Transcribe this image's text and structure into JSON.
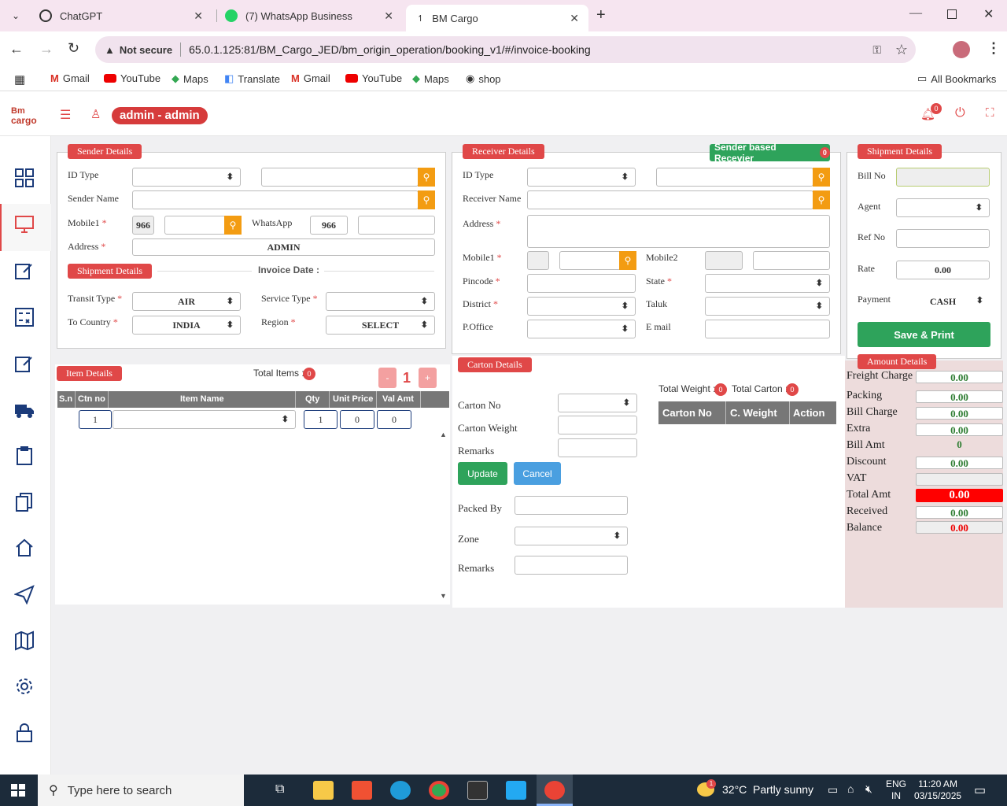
{
  "browser": {
    "tabs": [
      {
        "title": "ChatGPT"
      },
      {
        "title": "(7) WhatsApp Business"
      },
      {
        "title": "BM Cargo"
      }
    ],
    "security": "Not secure",
    "url": "65.0.1.125:81/BM_Cargo_JED/bm_origin_operation/booking_v1/#/invoice-booking",
    "bookmarks": [
      "Gmail",
      "YouTube",
      "Maps",
      "Translate",
      "Gmail",
      "YouTube",
      "Maps",
      "shop"
    ],
    "all_bookmarks": "All Bookmarks"
  },
  "app": {
    "logo_top": "Bm",
    "logo_bottom": "cargo",
    "user": "admin - admin",
    "notif_count": "0"
  },
  "sender": {
    "title": "Sender Details",
    "id_type": "ID Type",
    "sender_name": "Sender Name",
    "mobile_label": "Mobile1",
    "mobile_code": "966",
    "whatsapp_label": "WhatsApp",
    "whatsapp_code": "966",
    "address_label": "Address",
    "address_value": "ADMIN"
  },
  "shipment_sub": {
    "title": "Shipment Details",
    "invoice_date": "Invoice Date :",
    "transit_label": "Transit Type",
    "transit_value": "AIR",
    "service_label": "Service Type",
    "country_label": "To Country",
    "country_value": "INDIA",
    "region_label": "Region",
    "region_value": "SELECT"
  },
  "receiver": {
    "title": "Receiver Details",
    "sender_based": "Sender based Recevier",
    "sender_based_count": "0",
    "id_type": "ID Type",
    "receiver_name": "Receiver Name",
    "address": "Address",
    "mobile1": "Mobile1",
    "mobile2": "Mobile2",
    "pincode": "Pincode",
    "state": "State",
    "district": "District",
    "taluk": "Taluk",
    "poffice": "P.Office",
    "email": "E mail"
  },
  "shipment": {
    "title": "Shipment Details",
    "bill_no": "Bill No",
    "agent": "Agent",
    "ref_no": "Ref No",
    "rate": "Rate",
    "rate_value": "0.00",
    "payment": "Payment",
    "payment_value": "CASH",
    "save": "Save & Print"
  },
  "items": {
    "title": "Item Details",
    "total_label": "Total Items :",
    "total_count": "0",
    "minus": "-",
    "page": "1",
    "plus": "+",
    "headers": [
      "S.n",
      "Ctn no",
      "Item Name",
      "Qty",
      "Unit Price",
      "Val Amt"
    ],
    "row": {
      "ctn": "1",
      "qty": "1",
      "unit_price": "0",
      "val_amt": "0"
    }
  },
  "carton": {
    "title": "Carton Details",
    "carton_no": "Carton No",
    "carton_weight": "Carton Weight",
    "remarks": "Remarks",
    "update": "Update",
    "cancel": "Cancel",
    "packed_by": "Packed By",
    "zone": "Zone",
    "remarks2": "Remarks",
    "total_weight": "Total Weight :",
    "total_weight_count": "0",
    "total_carton": "Total Carton :",
    "total_carton_count": "0",
    "table_headers": [
      "Carton No",
      "C. Weight",
      "Action"
    ]
  },
  "amount": {
    "title": "Amount Details",
    "rows": [
      {
        "label": "Freight Charge",
        "value": "0.00"
      },
      {
        "label": "Packing",
        "value": "0.00"
      },
      {
        "label": "Bill Charge",
        "value": "0.00"
      },
      {
        "label": "Extra",
        "value": "0.00"
      },
      {
        "label": "Bill Amt",
        "value": "0"
      },
      {
        "label": "Discount",
        "value": "0.00"
      },
      {
        "label": "VAT",
        "value": ""
      },
      {
        "label": "Total Amt",
        "value": "0.00"
      },
      {
        "label": "Received",
        "value": "0.00"
      },
      {
        "label": "Balance",
        "value": "0.00"
      }
    ]
  },
  "taskbar": {
    "search_placeholder": "Type here to search",
    "temp": "32°C",
    "weather": "Partly sunny",
    "weather_badge": "1",
    "lang1": "ENG",
    "lang2": "IN",
    "time": "11:20 AM",
    "date": "03/15/2025"
  }
}
